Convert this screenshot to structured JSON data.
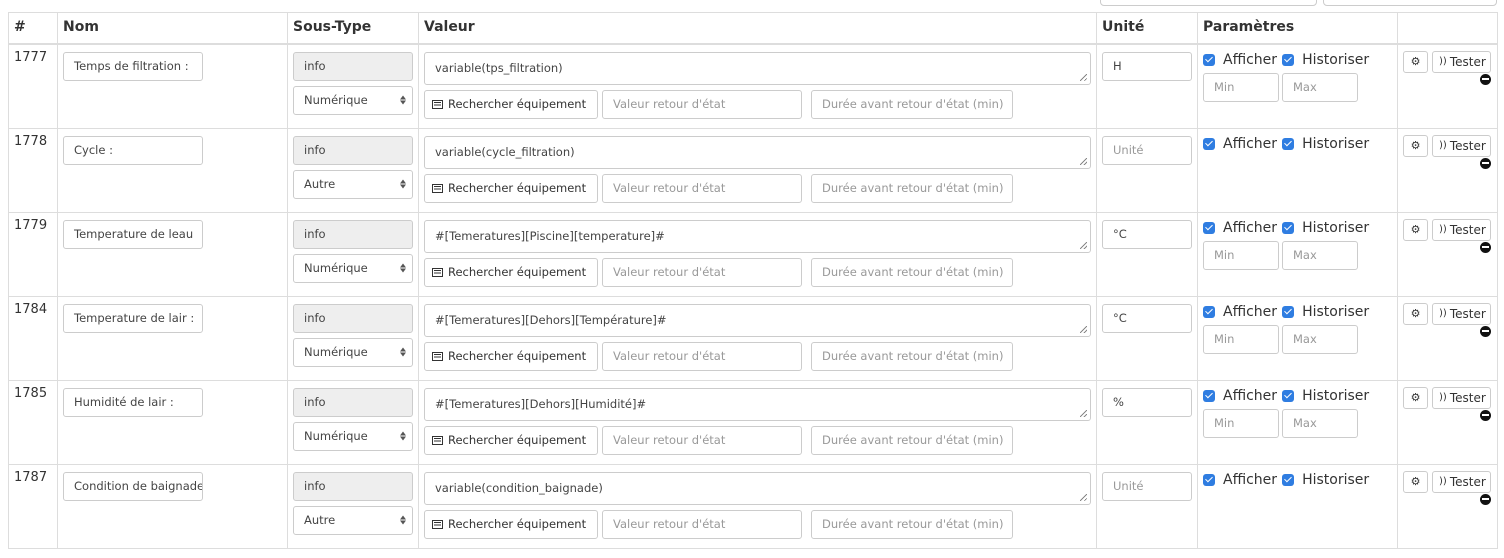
{
  "table": {
    "headers": {
      "id": "#",
      "name": "Nom",
      "subtype": "Sous-Type",
      "value": "Valeur",
      "unit": "Unité",
      "params": "Paramètres",
      "actions": ""
    },
    "placeholders": {
      "unit": "Unité",
      "return_value": "Valeur retour d'état",
      "return_duration": "Durée avant retour d'état (min)",
      "min": "Min",
      "max": "Max"
    },
    "labels": {
      "search_equipment": "Rechercher équipement",
      "show": "Afficher",
      "historize": "Historiser",
      "test": "Tester"
    },
    "icons": {
      "search_equipment": "list-icon",
      "config": "gears-icon",
      "test": "rss-icon",
      "remove": "minus-circle-icon"
    },
    "accent_color": "#2f7de1",
    "rows": [
      {
        "id": "1777",
        "name": "Temps de filtration :",
        "type": "info",
        "subtype": "Numérique",
        "value": "variable(tps_filtration)",
        "unit": "H",
        "show": true,
        "historize": true,
        "has_minmax": true
      },
      {
        "id": "1778",
        "name": "Cycle :",
        "type": "info",
        "subtype": "Autre",
        "value": "variable(cycle_filtration)",
        "unit": "",
        "show": true,
        "historize": true,
        "has_minmax": false
      },
      {
        "id": "1779",
        "name": "Temperature de leau",
        "type": "info",
        "subtype": "Numérique",
        "value": "#[Temeratures][Piscine][temperature]#",
        "unit": "°C",
        "show": true,
        "historize": true,
        "has_minmax": true
      },
      {
        "id": "1784",
        "name": "Temperature de lair :",
        "type": "info",
        "subtype": "Numérique",
        "value": "#[Temeratures][Dehors][Température]#",
        "unit": "°C",
        "show": true,
        "historize": true,
        "has_minmax": true
      },
      {
        "id": "1785",
        "name": "Humidité de lair :",
        "type": "info",
        "subtype": "Numérique",
        "value": "#[Temeratures][Dehors][Humidité]#",
        "unit": "%",
        "show": true,
        "historize": true,
        "has_minmax": true
      },
      {
        "id": "1787",
        "name": "Condition de baignade",
        "type": "info",
        "subtype": "Autre",
        "value": "variable(condition_baignade)",
        "unit": "",
        "show": true,
        "historize": true,
        "has_minmax": false
      }
    ]
  }
}
